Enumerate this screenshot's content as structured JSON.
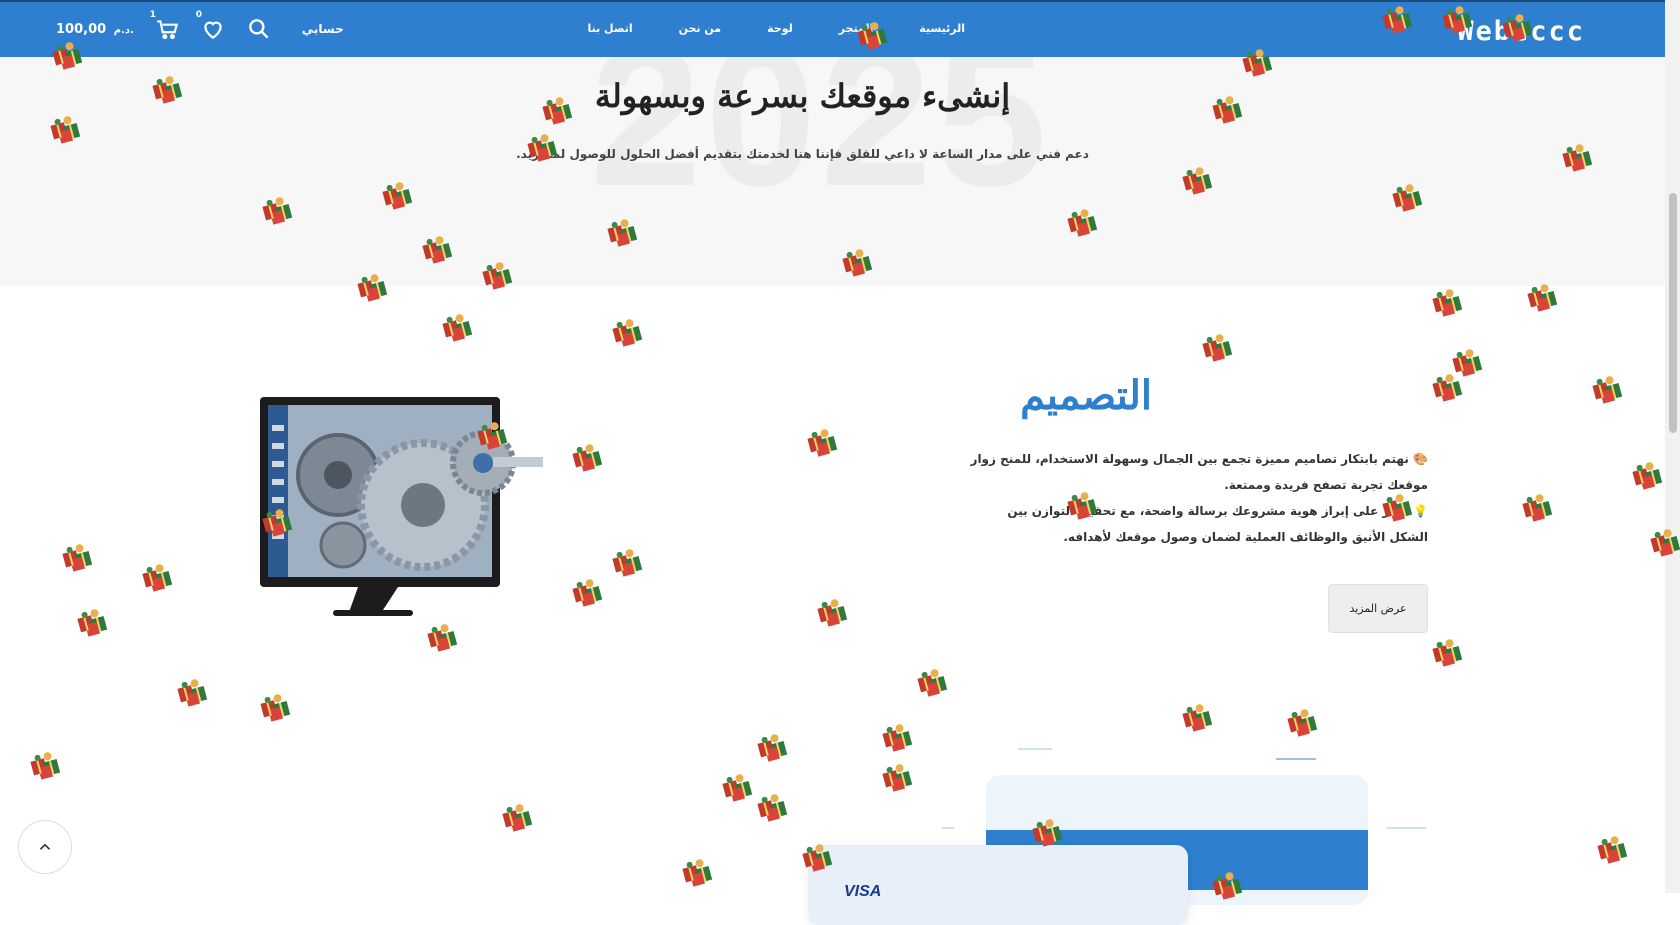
{
  "header": {
    "logo": "Webcccc",
    "nav": [
      "الرئيسية",
      "المتجر",
      "لوحة",
      "من نحن",
      "اتصل بنا"
    ],
    "account_label": "حسابي",
    "wishlist_count": "0",
    "cart_count": "1",
    "cart_total": "100,00",
    "currency": "د.م."
  },
  "hero": {
    "background_year": "2025",
    "title": "إنشىء موقعك بسرعة وبسهولة",
    "subtitle": "دعم فني على مدار الساعة لا داعي للقلق فإننا هنا لخدمتك بتقديم أفضل الحلول للوصول لما تريد."
  },
  "design": {
    "title": "التصميم",
    "point1_emoji": "🎨",
    "point1": "نهتم بابتكار تصاميم مميزة تجمع بين الجمال وسهولة الاستخدام، للمنح زوار موقعك تجربة تصفح فريدة وممتعة.",
    "point2_emoji": "💡",
    "point2": "نركز على إبراز هوية مشروعك برسالة واضحة، مع تحقيق التوازن بين الشكل الأنيق والوظائف العملية لضمان وصول موقعك لأهدافه.",
    "button_label": "عرض المزيد"
  },
  "illustration": {
    "card_brand": "VISA"
  },
  "colors": {
    "primary": "#2e7fcf",
    "hero_bg": "#f7f7f7"
  },
  "icons": [
    "search-icon",
    "heart-icon",
    "cart-icon",
    "chevron-up-icon",
    "gift-icon"
  ]
}
